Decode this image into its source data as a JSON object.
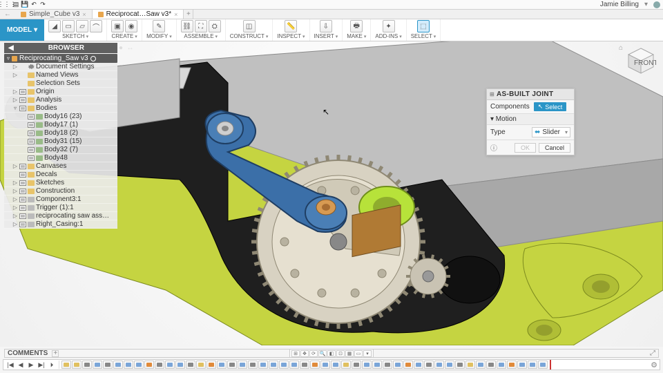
{
  "user": {
    "name": "Jamie Billing"
  },
  "qat": {
    "apps": "⋮⋮⋮",
    "file": "▤",
    "save": "💾",
    "undo": "↶",
    "redo": "↷"
  },
  "tabs": [
    {
      "label": "Simple_Cube v3",
      "active": false
    },
    {
      "label": "Reciprocat…Saw v3*",
      "active": true
    }
  ],
  "ribbon": {
    "workspace": "MODEL",
    "groups": [
      {
        "label": "SKETCH",
        "icons": [
          "◢",
          "▭",
          "▱",
          "⌒"
        ]
      },
      {
        "label": "CREATE",
        "icons": [
          "▣",
          "◉"
        ]
      },
      {
        "label": "MODIFY",
        "icons": [
          "✎"
        ]
      },
      {
        "label": "ASSEMBLE",
        "icons": [
          "⛓",
          "⛶",
          "⛭"
        ]
      },
      {
        "label": "CONSTRUCT",
        "icons": [
          "◫"
        ]
      },
      {
        "label": "INSPECT",
        "icons": [
          "📏"
        ]
      },
      {
        "label": "INSERT",
        "icons": [
          "⇩"
        ]
      },
      {
        "label": "MAKE",
        "icons": [
          "🖶"
        ]
      },
      {
        "label": "ADD-INS",
        "icons": [
          "✦"
        ]
      },
      {
        "label": "SELECT",
        "icons": [
          "⬚"
        ],
        "active": true
      }
    ]
  },
  "browser": {
    "title": "BROWSER",
    "root": "Reciprocating_Saw v3",
    "items": [
      {
        "ind": 1,
        "tri": "▷",
        "ic": "gear",
        "lbl": "Document Settings"
      },
      {
        "ind": 1,
        "tri": "▷",
        "ic": "folder",
        "lbl": "Named Views"
      },
      {
        "ind": 1,
        "tri": "",
        "ic": "folder",
        "lbl": "Selection Sets"
      },
      {
        "ind": 1,
        "tri": "▷",
        "ic": "folder",
        "lbl": "Origin",
        "chk": true
      },
      {
        "ind": 1,
        "tri": "▷",
        "ic": "folder",
        "lbl": "Analysis",
        "chk": true
      },
      {
        "ind": 1,
        "tri": "▿",
        "ic": "folder",
        "lbl": "Bodies",
        "chk": true
      },
      {
        "ind": 2,
        "tri": "",
        "ic": "body",
        "lbl": "Body16 (23)",
        "chk": true
      },
      {
        "ind": 2,
        "tri": "",
        "ic": "body",
        "lbl": "Body17 (1)",
        "chk": true
      },
      {
        "ind": 2,
        "tri": "",
        "ic": "body",
        "lbl": "Body18 (2)",
        "chk": true
      },
      {
        "ind": 2,
        "tri": "",
        "ic": "body",
        "lbl": "Body31 (15)",
        "chk": true
      },
      {
        "ind": 2,
        "tri": "",
        "ic": "body",
        "lbl": "Body32 (7)",
        "chk": true
      },
      {
        "ind": 2,
        "tri": "",
        "ic": "body",
        "lbl": "Body48",
        "chk": true
      },
      {
        "ind": 1,
        "tri": "▷",
        "ic": "folder",
        "lbl": "Canvases",
        "chk": true
      },
      {
        "ind": 1,
        "tri": "",
        "ic": "folder",
        "lbl": "Decals",
        "chk": true
      },
      {
        "ind": 1,
        "tri": "▷",
        "ic": "folder",
        "lbl": "Sketches",
        "chk": true
      },
      {
        "ind": 1,
        "tri": "▷",
        "ic": "folder",
        "lbl": "Construction",
        "chk": true
      },
      {
        "ind": 1,
        "tri": "▷",
        "ic": "comp",
        "lbl": "Component3:1",
        "chk": true
      },
      {
        "ind": 1,
        "tri": "▷",
        "ic": "comp",
        "lbl": "Trigger (1):1",
        "chk": true
      },
      {
        "ind": 1,
        "tri": "▷",
        "ic": "comp",
        "lbl": "reciprocating saw assembly gut...",
        "chk": true
      },
      {
        "ind": 1,
        "tri": "▷",
        "ic": "comp",
        "lbl": "Right_Casing:1",
        "chk": true
      }
    ]
  },
  "panel": {
    "title": "AS-BUILT JOINT",
    "components_label": "Components",
    "select_label": "Select",
    "motion_section": "▾ Motion",
    "type_label": "Type",
    "type_value": "Slider",
    "ok": "OK",
    "cancel": "Cancel"
  },
  "comments": {
    "label": "COMMENTS"
  },
  "viewcube": {
    "front": "FRONT"
  },
  "timeline": {
    "controls": [
      "|◀",
      "◀",
      "▶",
      "▶|",
      "⏵"
    ],
    "features": [
      "y",
      "y",
      "g",
      "b",
      "g",
      "b",
      "b",
      "b",
      "o",
      "g",
      "b",
      "b",
      "g",
      "y",
      "o",
      "b",
      "g",
      "b",
      "g",
      "b",
      "b",
      "b",
      "b",
      "g",
      "o",
      "b",
      "b",
      "y",
      "g",
      "b",
      "b",
      "g",
      "b",
      "o",
      "b",
      "g",
      "b",
      "b",
      "g",
      "y",
      "b",
      "g",
      "b",
      "o",
      "b",
      "b",
      "b"
    ]
  },
  "vpbar": [
    "⊞",
    "✥",
    "⟳",
    "🔍",
    "◧",
    "⊡",
    "▦",
    "▭",
    "▾"
  ]
}
